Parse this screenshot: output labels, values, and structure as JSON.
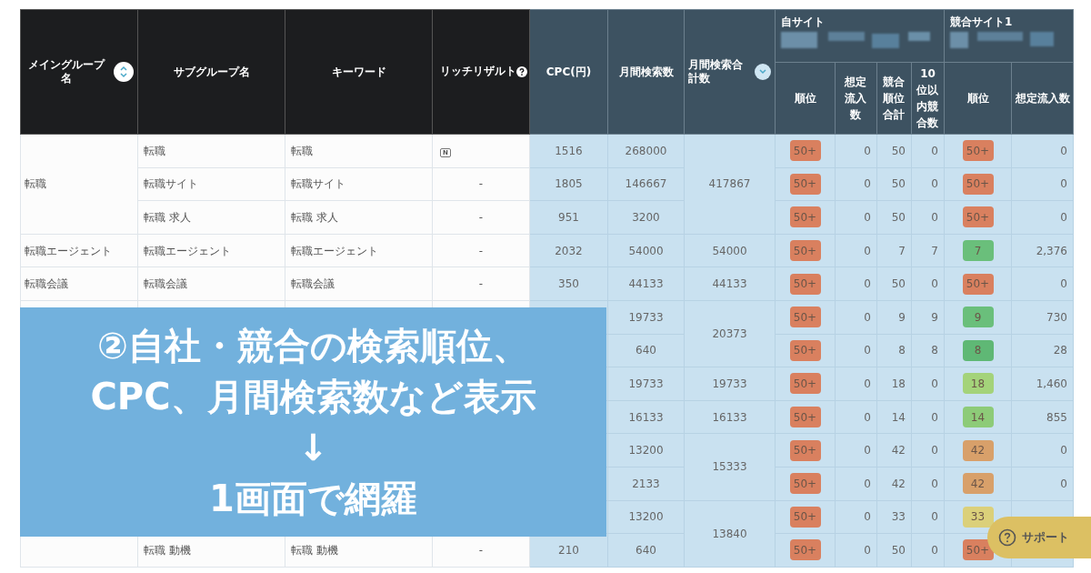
{
  "table": {
    "header": {
      "main_group": "メイングループ名",
      "subgroup": "サブグループ名",
      "keyword": "キーワード",
      "rich_result": "リッチリザルト",
      "cpc": "CPC(円)",
      "monthly": "月間検索数",
      "monthly_total": "月間検索合計数",
      "own_site": {
        "title": "自サイト",
        "columns": [
          "順位",
          "想定流入数",
          "競合順位合計",
          "10位以内競合数"
        ]
      },
      "competitor": {
        "title": "競合サイト1",
        "columns": [
          "順位",
          "想定流入数"
        ]
      }
    },
    "main_groups": [
      {
        "name": "転職",
        "total_groups": [
          {
            "monthly_total": "417867",
            "rows": [
              {
                "subgroup": "転職",
                "keyword": "転職",
                "rich_result": {
                  "kind": "badge",
                  "text": "N"
                },
                "cpc": "1516",
                "monthly": "268000",
                "own": {
                  "rank": {
                    "text": "50+",
                    "color": "#d9805f"
                  },
                  "flow": "0",
                  "rank_total": "50",
                  "top10": "0"
                },
                "comp": {
                  "rank": {
                    "text": "50+",
                    "color": "#d9805f"
                  },
                  "flow": "0"
                }
              },
              {
                "subgroup": "転職サイト",
                "keyword": "転職サイト",
                "rich_result": {
                  "kind": "text",
                  "text": "-"
                },
                "cpc": "1805",
                "monthly": "146667",
                "own": {
                  "rank": {
                    "text": "50+",
                    "color": "#d9805f"
                  },
                  "flow": "0",
                  "rank_total": "50",
                  "top10": "0"
                },
                "comp": {
                  "rank": {
                    "text": "50+",
                    "color": "#d9805f"
                  },
                  "flow": "0"
                }
              },
              {
                "subgroup": "転職 求人",
                "keyword": "転職 求人",
                "rich_result": {
                  "kind": "text",
                  "text": "-"
                },
                "cpc": "951",
                "monthly": "3200",
                "own": {
                  "rank": {
                    "text": "50+",
                    "color": "#d9805f"
                  },
                  "flow": "0",
                  "rank_total": "50",
                  "top10": "0"
                },
                "comp": {
                  "rank": {
                    "text": "50+",
                    "color": "#d9805f"
                  },
                  "flow": "0"
                }
              }
            ]
          }
        ]
      },
      {
        "name": "転職エージェント",
        "total_groups": [
          {
            "monthly_total": "54000",
            "rows": [
              {
                "subgroup": "転職エージェント",
                "keyword": "転職エージェント",
                "rich_result": {
                  "kind": "text",
                  "text": "-"
                },
                "cpc": "2032",
                "monthly": "54000",
                "own": {
                  "rank": {
                    "text": "50+",
                    "color": "#d9805f"
                  },
                  "flow": "0",
                  "rank_total": "7",
                  "top10": "7"
                },
                "comp": {
                  "rank": {
                    "text": "7",
                    "color": "#6abf7b"
                  },
                  "flow": "2,376"
                }
              }
            ]
          }
        ]
      },
      {
        "name": "転職会議",
        "total_groups": [
          {
            "monthly_total": "44133",
            "rows": [
              {
                "subgroup": "転職会議",
                "keyword": "転職会議",
                "rich_result": {
                  "kind": "text",
                  "text": "-"
                },
                "cpc": "350",
                "monthly": "44133",
                "own": {
                  "rank": {
                    "text": "50+",
                    "color": "#d9805f"
                  },
                  "flow": "0",
                  "rank_total": "50",
                  "top10": "0"
                },
                "comp": {
                  "rank": {
                    "text": "50+",
                    "color": "#d9805f"
                  },
                  "flow": "0"
                }
              }
            ]
          }
        ]
      },
      {
        "total_groups": [
          {
            "monthly_total": "20373",
            "rows": [
              {
                "monthly": "19733",
                "own": {
                  "rank": {
                    "text": "50+",
                    "color": "#d9805f"
                  },
                  "flow": "0",
                  "rank_total": "9",
                  "top10": "9"
                },
                "comp": {
                  "rank": {
                    "text": "9",
                    "color": "#6abf7b"
                  },
                  "flow": "730"
                }
              },
              {
                "monthly": "640",
                "own": {
                  "rank": {
                    "text": "50+",
                    "color": "#d9805f"
                  },
                  "flow": "0",
                  "rank_total": "8",
                  "top10": "8"
                },
                "comp": {
                  "rank": {
                    "text": "8",
                    "color": "#5fb875"
                  },
                  "flow": "28"
                }
              }
            ]
          },
          {
            "monthly_total": "19733",
            "rows": [
              {
                "monthly": "19733",
                "own": {
                  "rank": {
                    "text": "50+",
                    "color": "#d9805f"
                  },
                  "flow": "0",
                  "rank_total": "18",
                  "top10": "0"
                },
                "comp": {
                  "rank": {
                    "text": "18",
                    "color": "#a4d37a"
                  },
                  "flow": "1,460"
                }
              }
            ]
          },
          {
            "monthly_total": "16133",
            "rows": [
              {
                "monthly": "16133",
                "own": {
                  "rank": {
                    "text": "50+",
                    "color": "#d9805f"
                  },
                  "flow": "0",
                  "rank_total": "14",
                  "top10": "0"
                },
                "comp": {
                  "rank": {
                    "text": "14",
                    "color": "#8dcb78"
                  },
                  "flow": "855"
                }
              }
            ]
          },
          {
            "monthly_total": "15333",
            "rows": [
              {
                "monthly": "13200",
                "own": {
                  "rank": {
                    "text": "50+",
                    "color": "#d9805f"
                  },
                  "flow": "0",
                  "rank_total": "42",
                  "top10": "0"
                },
                "comp": {
                  "rank": {
                    "text": "42",
                    "color": "#d8a06a"
                  },
                  "flow": "0"
                }
              },
              {
                "monthly": "2133",
                "own": {
                  "rank": {
                    "text": "50+",
                    "color": "#d9805f"
                  },
                  "flow": "0",
                  "rank_total": "42",
                  "top10": "0"
                },
                "comp": {
                  "rank": {
                    "text": "42",
                    "color": "#d8a06a"
                  },
                  "flow": "0"
                }
              }
            ]
          },
          {
            "monthly_total": "13840",
            "rows": [
              {
                "monthly": "13200",
                "own": {
                  "rank": {
                    "text": "50+",
                    "color": "#d9805f"
                  },
                  "flow": "0",
                  "rank_total": "33",
                  "top10": "0"
                },
                "comp": {
                  "rank": {
                    "text": "33",
                    "color": "#dbd07a"
                  }
                }
              },
              {
                "subgroup": "転職 動機",
                "keyword": "転職 動機",
                "rich_result": {
                  "kind": "text",
                  "text": "-"
                },
                "cpc": "210",
                "monthly": "640",
                "own": {
                  "rank": {
                    "text": "50+",
                    "color": "#d9805f"
                  },
                  "flow": "0",
                  "rank_total": "50",
                  "top10": "0"
                },
                "comp": {
                  "rank": {
                    "text": "50+",
                    "color": "#d9805f"
                  }
                }
              }
            ]
          }
        ]
      }
    ]
  },
  "banner": {
    "lines": [
      "②自社・競合の検索順位、",
      "CPC、月間検索数など表示",
      "↓",
      "1画面で網羅"
    ]
  },
  "support_button": {
    "label": "サポート"
  }
}
